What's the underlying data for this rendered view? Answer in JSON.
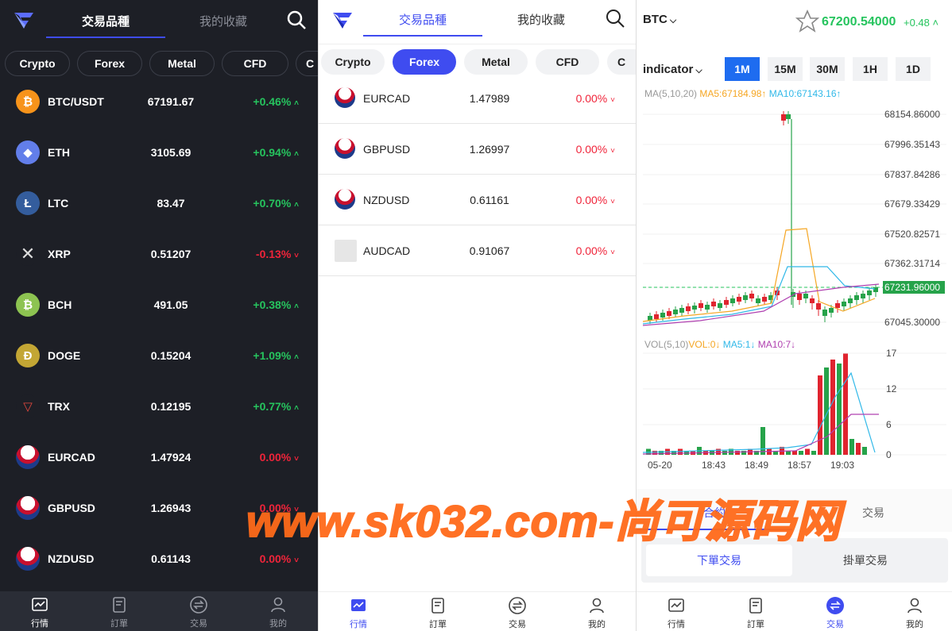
{
  "list_dark": {
    "tabs": [
      "交易品種",
      "我的收藏"
    ],
    "chips": [
      "Crypto",
      "Forex",
      "Metal",
      "CFD",
      "C"
    ],
    "rows": [
      {
        "symbol": "BTC/USDT",
        "price": "67191.67",
        "change": "+0.46%",
        "dir": "up",
        "icon": "bitcoin-icon",
        "color": "#f7931a",
        "glyph": "₿"
      },
      {
        "symbol": "ETH",
        "price": "3105.69",
        "change": "+0.94%",
        "dir": "up",
        "icon": "ethereum-icon",
        "color": "#627eea",
        "glyph": "◆"
      },
      {
        "symbol": "LTC",
        "price": "83.47",
        "change": "+0.70%",
        "dir": "up",
        "icon": "litecoin-icon",
        "color": "#345d9d",
        "glyph": "Ł"
      },
      {
        "symbol": "XRP",
        "price": "0.51207",
        "change": "-0.13%",
        "dir": "dn",
        "icon": "xrp-icon",
        "color": "#1d1f26",
        "glyph": "✕"
      },
      {
        "symbol": "BCH",
        "price": "491.05",
        "change": "+0.38%",
        "dir": "up",
        "icon": "bitcoin-cash-icon",
        "color": "#8dc351",
        "glyph": "₿"
      },
      {
        "symbol": "DOGE",
        "price": "0.15204",
        "change": "+1.09%",
        "dir": "up",
        "icon": "dogecoin-icon",
        "color": "#c3a634",
        "glyph": "Ð"
      },
      {
        "symbol": "TRX",
        "price": "0.12195",
        "change": "+0.77%",
        "dir": "up",
        "icon": "tron-icon",
        "color": "#1d1f26",
        "glyph": "▽"
      },
      {
        "symbol": "EURCAD",
        "price": "1.47924",
        "change": "0.00%",
        "dir": "dn",
        "icon": "flag-canada-icon",
        "color": "#1d3b8a",
        "glyph": ""
      },
      {
        "symbol": "GBPUSD",
        "price": "1.26943",
        "change": "0.00%",
        "dir": "dn",
        "icon": "flag-uk-icon",
        "color": "#1d3b8a",
        "glyph": ""
      },
      {
        "symbol": "NZDUSD",
        "price": "0.61143",
        "change": "0.00%",
        "dir": "dn",
        "icon": "flag-nz-icon",
        "color": "#1d3b8a",
        "glyph": ""
      }
    ]
  },
  "list_light": {
    "tabs": [
      "交易品種",
      "我的收藏"
    ],
    "chips": [
      "Crypto",
      "Forex",
      "Metal",
      "CFD",
      "C"
    ],
    "rows": [
      {
        "symbol": "EURCAD",
        "price": "1.47989",
        "change": "0.00%",
        "icon": "flag-canada-icon"
      },
      {
        "symbol": "GBPUSD",
        "price": "1.26997",
        "change": "0.00%",
        "icon": "flag-uk-icon"
      },
      {
        "symbol": "NZDUSD",
        "price": "0.61161",
        "change": "0.00%",
        "icon": "flag-nz-icon"
      },
      {
        "symbol": "AUDCAD",
        "price": "0.91067",
        "change": "0.00%",
        "icon": "placeholder-avatar-icon"
      }
    ]
  },
  "nav": [
    "行情",
    "訂單",
    "交易",
    "我的"
  ],
  "detail": {
    "symbol": "BTC",
    "price": "67200.54000",
    "change": "+0.48",
    "indicator_label": "indicator",
    "timeframes": [
      "1M",
      "15M",
      "30M",
      "1H",
      "1D"
    ],
    "ma_label": "MA(5,10,20)",
    "ma5": "MA5:67184.98↑",
    "ma10": "MA10:67143.16↑",
    "vol_label": "VOL(5,10)",
    "vol": "VOL:0↓",
    "vol_ma5": "MA5:1↓",
    "vol_ma10": "MA10:7↓",
    "y_ticks": [
      "68154.86000",
      "67996.35143",
      "67837.84286",
      "67679.33429",
      "67520.82571",
      "67362.31714",
      "67231.96000",
      "67045.30000"
    ],
    "vol_ticks": [
      "17",
      "12",
      "6",
      "0"
    ],
    "x_ticks": [
      "05-20",
      "18:43",
      "18:49",
      "18:57",
      "19:03"
    ],
    "tab_left": "合約",
    "tab_right": "交易",
    "buttons": [
      "下單交易",
      "掛單交易"
    ]
  },
  "watermark": "www.sk032.com-尚可源码网",
  "colors": {
    "up": "#26c45e",
    "down": "#f0243a",
    "accent": "#3f4cf0",
    "dark_bg": "#1d1f26"
  }
}
